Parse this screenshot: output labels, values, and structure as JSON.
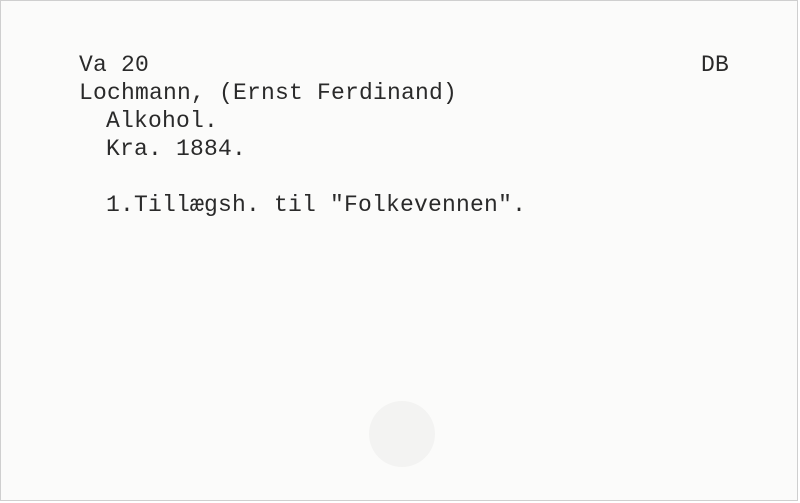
{
  "card": {
    "call_number": "Va 20",
    "library_code": "DB",
    "author": "Lochmann, (Ernst Ferdinand)",
    "title": "Alkohol.",
    "imprint": "Kra. 1884.",
    "note": "1.Tillægsh. til \"Folkevennen\"."
  }
}
